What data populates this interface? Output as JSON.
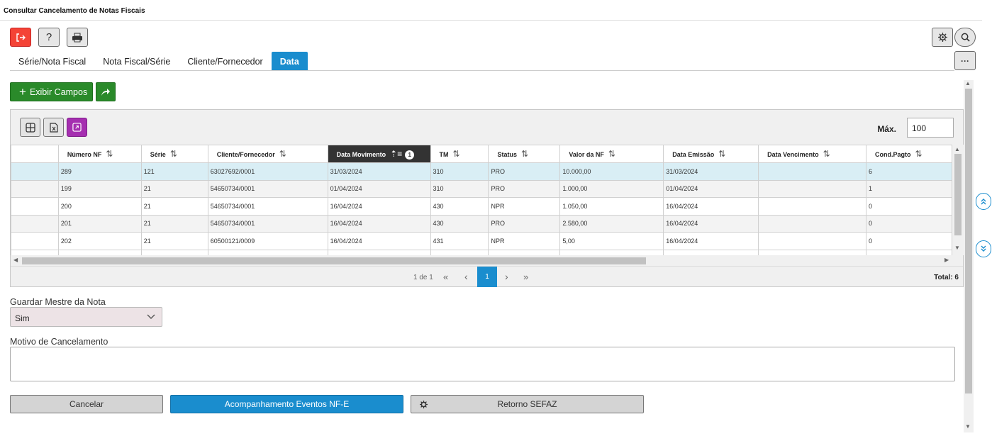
{
  "window": {
    "title": "Consultar Cancelamento de Notas Fiscais"
  },
  "toolbar": {
    "exit_icon": "exit-icon",
    "help_label": "?",
    "print_icon": "printer-icon"
  },
  "tabs": [
    {
      "label": "Série/Nota Fiscal",
      "active": false
    },
    {
      "label": "Nota Fiscal/Série",
      "active": false
    },
    {
      "label": "Cliente/Fornecedor",
      "active": false
    },
    {
      "label": "Data",
      "active": true
    }
  ],
  "actions": {
    "show_fields_label": "Exibir Campos",
    "more_label": "···"
  },
  "grid": {
    "max_label": "Máx.",
    "max_value": "100",
    "sort_badge": "1",
    "columns": [
      "Número NF",
      "Série",
      "Cliente/Fornecedor",
      "Data Movimento",
      "TM",
      "Status",
      "Valor da NF",
      "Data Emissão",
      "Data Vencimento",
      "Cond.Pagto"
    ],
    "rows": [
      [
        "289",
        "121",
        "63027692/0001",
        "31/03/2024",
        "310",
        "PRO",
        "10.000,00",
        "31/03/2024",
        "",
        "6"
      ],
      [
        "199",
        "21",
        "54650734/0001",
        "01/04/2024",
        "310",
        "PRO",
        "1.000,00",
        "01/04/2024",
        "",
        "1"
      ],
      [
        "200",
        "21",
        "54650734/0001",
        "16/04/2024",
        "430",
        "NPR",
        "1.050,00",
        "16/04/2024",
        "",
        "0"
      ],
      [
        "201",
        "21",
        "54650734/0001",
        "16/04/2024",
        "430",
        "PRO",
        "2.580,00",
        "16/04/2024",
        "",
        "0"
      ],
      [
        "202",
        "21",
        "60500121/0009",
        "16/04/2024",
        "431",
        "NPR",
        "5,00",
        "16/04/2024",
        "",
        "0"
      ]
    ],
    "pager": {
      "info": "1 de 1",
      "first": "«",
      "prev": "‹",
      "current": "1",
      "next": "›",
      "last": "»",
      "total": "Total: 6"
    }
  },
  "form": {
    "guardar_label": "Guardar Mestre da Nota",
    "guardar_value": "Sim",
    "motivo_label": "Motivo de Cancelamento",
    "motivo_value": ""
  },
  "buttons": {
    "cancel": "Cancelar",
    "events": "Acompanhamento Eventos NF-E",
    "sefaz": "Retorno SEFAZ"
  },
  "colors": {
    "accent": "#1a8dce",
    "green": "#2a8a2a",
    "danger": "#f44336",
    "purple": "#a52fb0",
    "selected_row": "#d9eef5"
  }
}
